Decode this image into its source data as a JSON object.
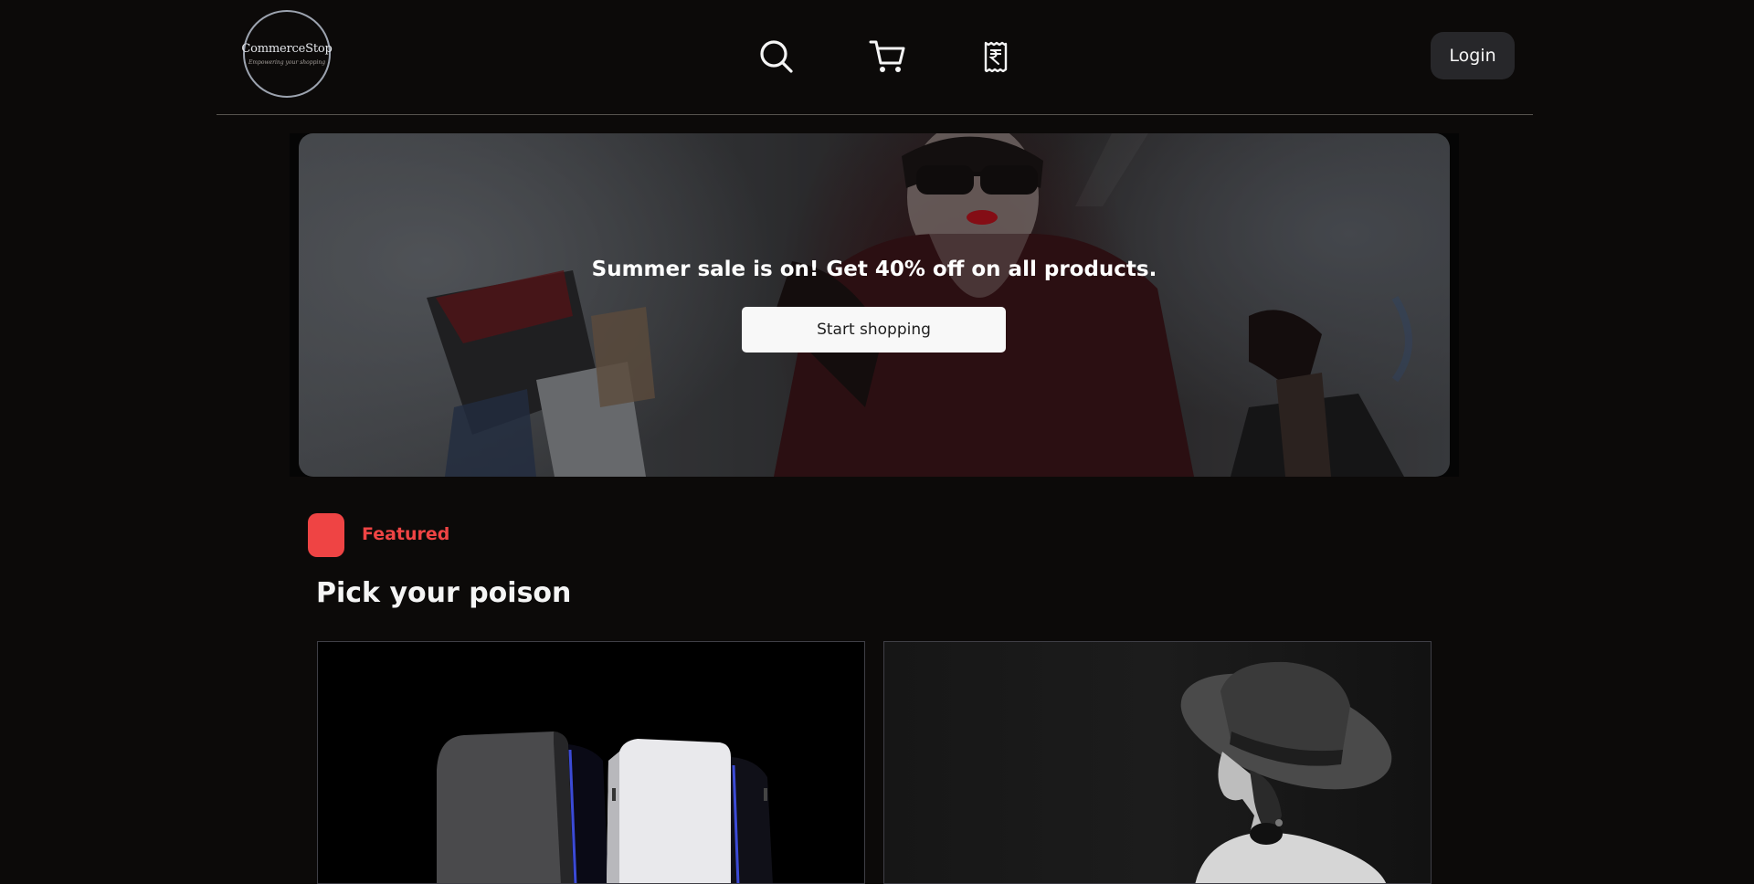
{
  "brand": {
    "name": "CommerceStop",
    "tagline": "Empowering your shopping"
  },
  "nav": {
    "search_icon": "search-icon",
    "cart_icon": "cart-icon",
    "orders_icon": "rupee-receipt-icon",
    "login_label": "Login"
  },
  "hero": {
    "headline": "Summer sale is on! Get 40% off on all products.",
    "cta_label": "Start shopping"
  },
  "featured": {
    "label": "Featured",
    "title": "Pick your poison",
    "accent_color": "#ef4444",
    "products": [
      {
        "image": "game-consoles-image"
      },
      {
        "image": "woman-in-hat-image"
      }
    ]
  }
}
